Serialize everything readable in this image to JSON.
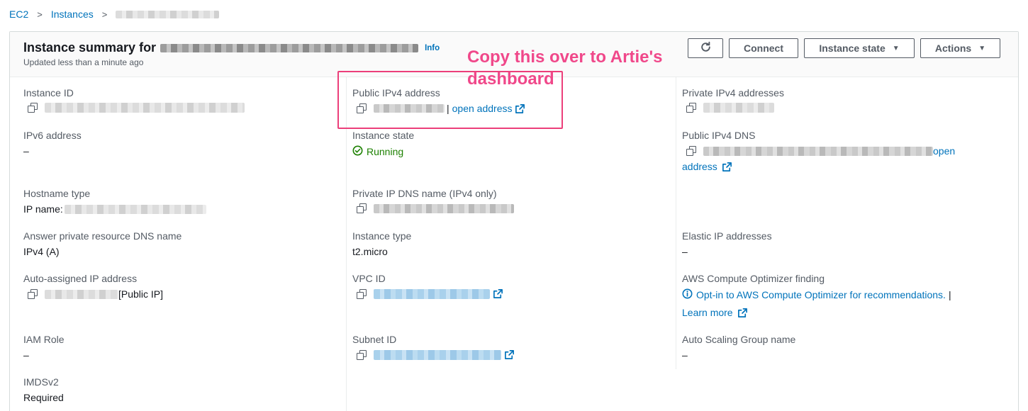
{
  "breadcrumb": {
    "home": "EC2",
    "instances": "Instances"
  },
  "header": {
    "title": "Instance summary for",
    "info": "Info",
    "updated": "Updated less than a minute ago"
  },
  "toolbar": {
    "connect": "Connect",
    "instance_state": "Instance state",
    "actions": "Actions"
  },
  "annotation": {
    "line1": "Copy this over to Artie's",
    "line2": "dashboard"
  },
  "details": {
    "instance_id": {
      "label": "Instance ID"
    },
    "ipv6": {
      "label": "IPv6 address",
      "value": "–"
    },
    "hostname_type": {
      "label": "Hostname type",
      "value_prefix": "IP name:"
    },
    "answer_dns": {
      "label": "Answer private resource DNS name",
      "value": "IPv4 (A)"
    },
    "auto_ip": {
      "label": "Auto-assigned IP address",
      "suffix": "[Public IP]"
    },
    "iam_role": {
      "label": "IAM Role",
      "value": "–"
    },
    "imdsv2": {
      "label": "IMDSv2",
      "value": "Required"
    },
    "public_ipv4": {
      "label": "Public IPv4 address",
      "separator": "|",
      "link": "open address"
    },
    "instance_state": {
      "label": "Instance state",
      "value": "Running"
    },
    "private_dns": {
      "label": "Private IP DNS name (IPv4 only)"
    },
    "instance_type": {
      "label": "Instance type",
      "value": "t2.micro"
    },
    "vpc_id": {
      "label": "VPC ID"
    },
    "subnet_id": {
      "label": "Subnet ID"
    },
    "private_ipv4": {
      "label": "Private IPv4 addresses"
    },
    "public_dns": {
      "label": "Public IPv4 DNS",
      "link_line1": "open",
      "link_line2": "address"
    },
    "elastic_ip": {
      "label": "Elastic IP addresses",
      "value": "–"
    },
    "optimizer": {
      "label": "AWS Compute Optimizer finding",
      "link": "Opt-in to AWS Compute Optimizer for recommendations.",
      "separator": "|",
      "learn_more": "Learn more"
    },
    "asg": {
      "label": "Auto Scaling Group name",
      "value": "–"
    }
  },
  "colors": {
    "link": "#0073bb",
    "running": "#1d8102",
    "annotation": "#f0488a",
    "label": "#545b64"
  }
}
